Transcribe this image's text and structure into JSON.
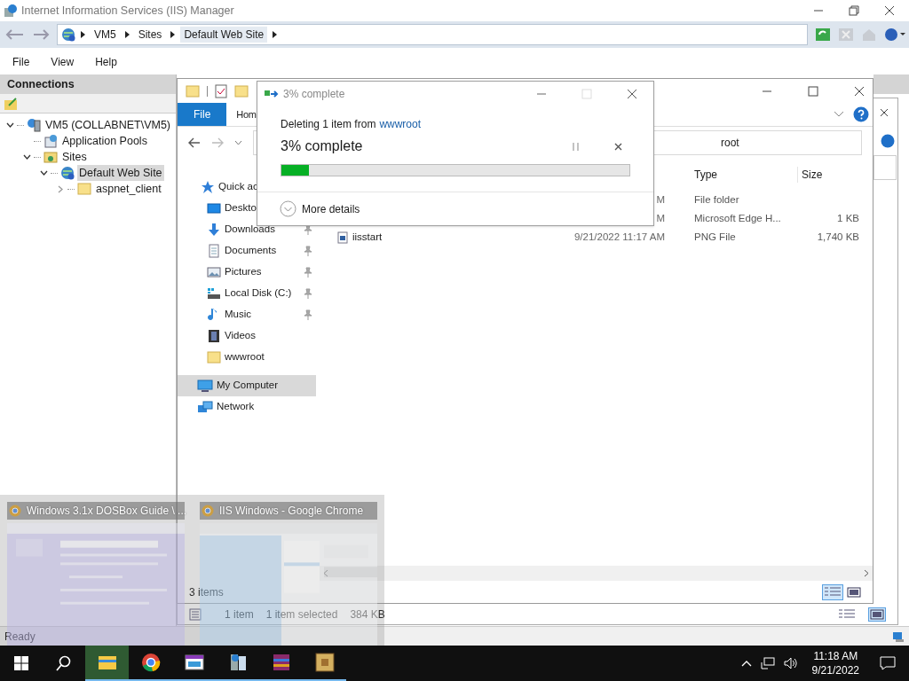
{
  "iis": {
    "title": "Internet Information Services (IIS) Manager",
    "breadcrumb": [
      "VM5",
      "Sites",
      "Default Web Site"
    ],
    "menu": [
      "File",
      "View",
      "Help"
    ],
    "connections_title": "Connections",
    "tree": [
      {
        "label": "VM5 (COLLABNET\\VM5)",
        "kind": "server",
        "expanded": true,
        "selected": false,
        "children": [
          {
            "label": "Application Pools",
            "kind": "pools",
            "selected": false
          },
          {
            "label": "Sites",
            "kind": "sites",
            "expanded": true,
            "selected": false,
            "children": [
              {
                "label": "Default Web Site",
                "kind": "site",
                "expanded": true,
                "selected": true,
                "children": [
                  {
                    "label": "aspnet_client",
                    "kind": "folder",
                    "expanded": false,
                    "selected": false
                  }
                ]
              }
            ]
          }
        ]
      }
    ],
    "status": "Ready"
  },
  "explorer": {
    "ribbon_tabs": [
      {
        "label": "File",
        "selected": true
      },
      {
        "label": "Hom",
        "selected": false
      }
    ],
    "address": "root",
    "columns": [
      "Type",
      "Size"
    ],
    "rows": [
      {
        "date": "M",
        "type": "File folder"
      },
      {
        "date": "M",
        "type": "Microsoft Edge H...",
        "size": "1 KB"
      },
      {
        "name": "iisstart",
        "date": "9/21/2022 11:17 AM",
        "type": "PNG File",
        "size": "1,740 KB"
      }
    ],
    "nav": [
      {
        "label": "Quick ac",
        "kind": "star",
        "selected": false,
        "children": [
          {
            "label": "Deskto",
            "kind": "desktop",
            "selected": false
          },
          {
            "label": "Downloads",
            "kind": "download",
            "pinned": true,
            "selected": false
          },
          {
            "label": "Documents",
            "kind": "document",
            "pinned": true,
            "selected": false
          },
          {
            "label": "Pictures",
            "kind": "pictures",
            "pinned": true,
            "selected": false
          },
          {
            "label": "Local Disk (C:)",
            "kind": "disk",
            "pinned": true,
            "selected": false
          },
          {
            "label": "Music",
            "kind": "music",
            "pinned": true,
            "selected": false
          },
          {
            "label": "Videos",
            "kind": "video",
            "pinned": false,
            "selected": false
          },
          {
            "label": "wwwroot",
            "kind": "folder",
            "pinned": false,
            "selected": false
          }
        ]
      },
      {
        "label": "My Computer",
        "kind": "computer",
        "selected": true
      },
      {
        "label": "Network",
        "kind": "network",
        "selected": false
      }
    ],
    "status": "3 items"
  },
  "explorer_behind": {
    "status": [
      "1 item",
      "1 item selected",
      "384 KB"
    ]
  },
  "dialog": {
    "title": "3% complete",
    "message": "Deleting 1 item from",
    "source": "wwwroot",
    "heading": "3% complete",
    "level": 0.08,
    "details": "More details"
  },
  "thumbnails": [
    {
      "title": "Windows 3.1x DOSBox Guide \\ ...",
      "kind": "picture"
    },
    {
      "title": "IIS Windows - Google Chrome",
      "kind": "picture"
    }
  ],
  "taskbar": {
    "apps": [
      {
        "kind": "explorer",
        "selected": true
      },
      {
        "kind": "chrome",
        "selected": false
      },
      {
        "kind": "window",
        "selected": false
      },
      {
        "kind": "server",
        "selected": false
      },
      {
        "kind": "archive",
        "selected": false
      },
      {
        "kind": "dosbox",
        "selected": false
      }
    ],
    "time": "11:18 AM",
    "date": "9/21/2022"
  }
}
